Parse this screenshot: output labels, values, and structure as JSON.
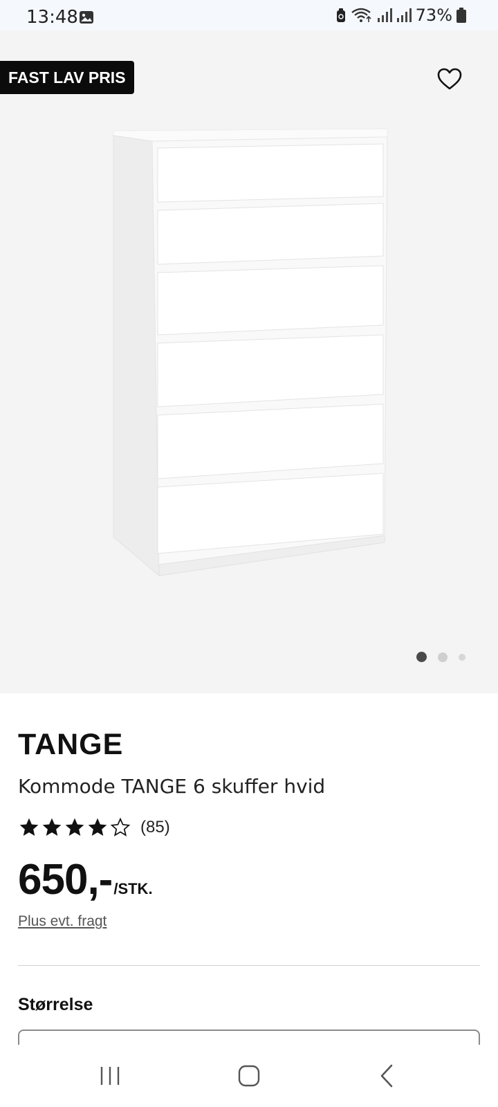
{
  "status_bar": {
    "time": "13:48",
    "battery": "73%",
    "icons": [
      "gallery-icon",
      "recycle-icon",
      "wifi-icon",
      "signal-icon",
      "signal-icon",
      "battery-icon"
    ]
  },
  "product_image": {
    "badge": "FAST LAV PRIS",
    "favorite_icon": "heart-outline-icon",
    "carousel": {
      "count": 3,
      "active_index": 0
    }
  },
  "product": {
    "brand": "TANGE",
    "name": "Kommode TANGE 6 skuffer hvid",
    "rating": 4,
    "rating_max": 5,
    "review_count": "(85)",
    "price": "650,-",
    "unit": "/STK.",
    "freight_link": "Plus evt. fragt"
  },
  "size_section": {
    "label": "Størrelse"
  },
  "nav_bar": {
    "icons": [
      "recent-apps-icon",
      "home-icon",
      "back-icon"
    ]
  }
}
